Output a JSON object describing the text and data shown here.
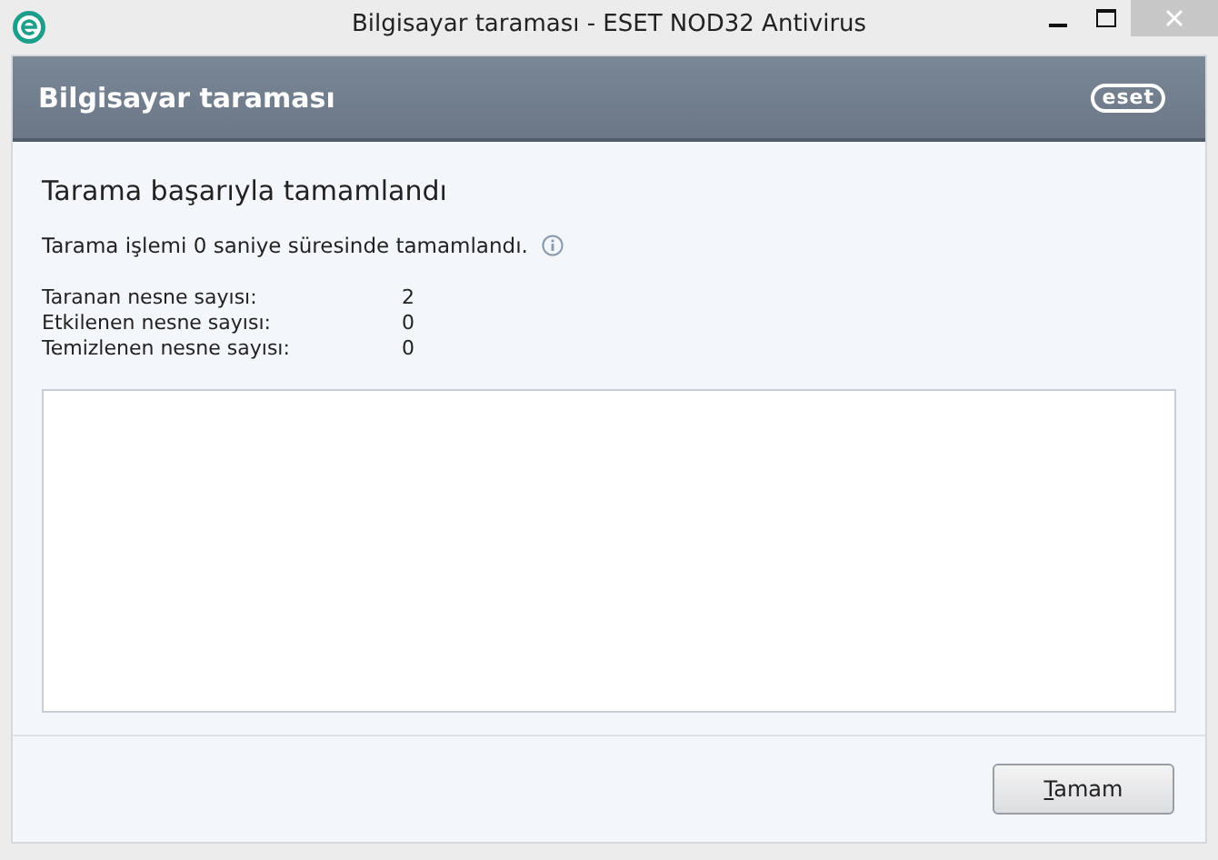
{
  "window": {
    "title": "Bilgisayar taraması - ESET NOD32 Antivirus"
  },
  "header": {
    "title": "Bilgisayar taraması",
    "logo": "eset"
  },
  "result": {
    "heading": "Tarama başarıyla tamamlandı",
    "summary": "Tarama işlemi 0 saniye süresinde tamamlandı."
  },
  "stats": [
    {
      "label": "Taranan nesne sayısı:",
      "value": "2"
    },
    {
      "label": "Etkilenen nesne sayısı:",
      "value": "0"
    },
    {
      "label": "Temizlenen nesne sayısı:",
      "value": "0"
    }
  ],
  "buttons": [
    {
      "mnemonic": "T",
      "rest": "amam"
    }
  ]
}
